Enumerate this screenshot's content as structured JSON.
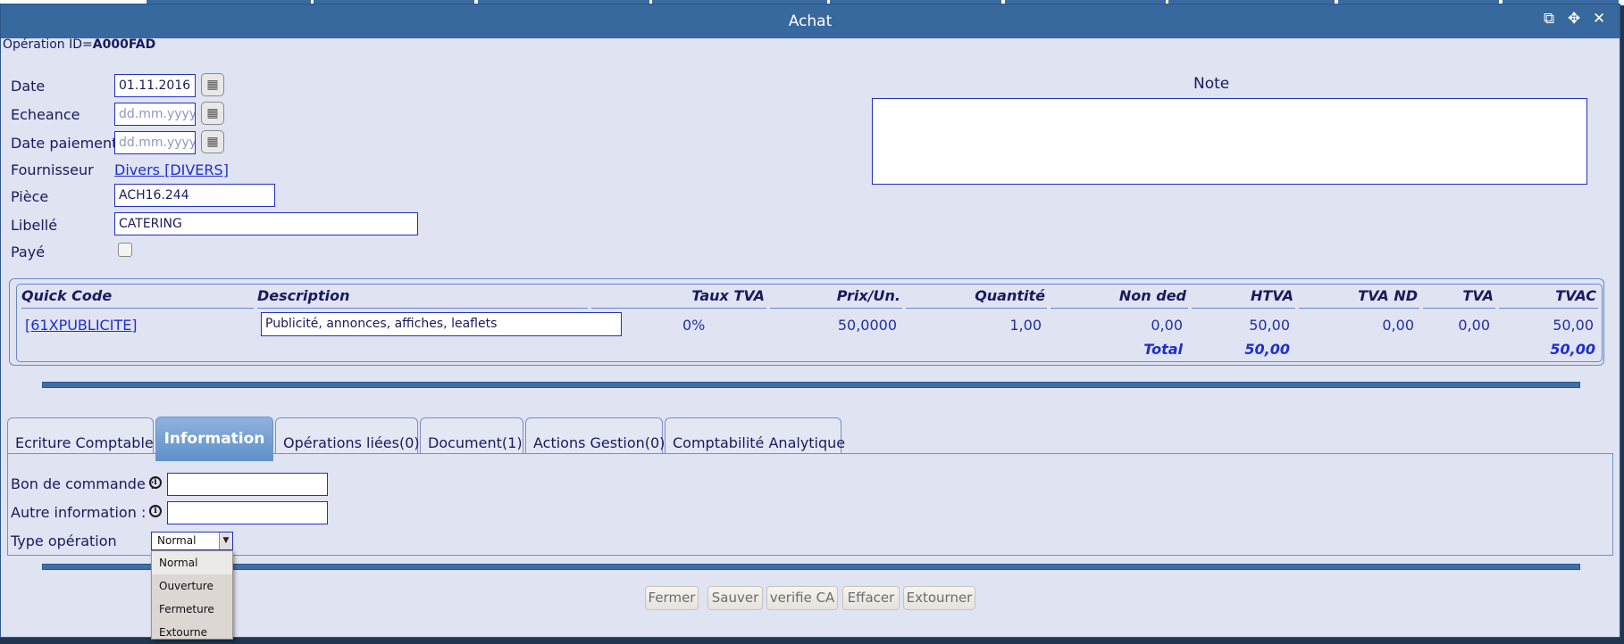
{
  "dialog": {
    "title": "Achat",
    "operation_id_label": "Opération ID=",
    "operation_id_value": "A000FAD"
  },
  "form": {
    "date_label": "Date",
    "date_value": "01.11.2016",
    "echeance_label": "Echeance",
    "echeance_placeholder": "dd.mm.yyyy",
    "date_paiement_label": "Date paiement",
    "date_paiement_placeholder": "dd.mm.yyyy",
    "fournisseur_label": "Fournisseur",
    "fournisseur_value": "Divers [DIVERS]",
    "piece_label": "Pièce",
    "piece_value": "ACH16.244",
    "libelle_label": "Libellé",
    "libelle_value": "CATERING",
    "paye_label": "Payé",
    "paye_checked": false
  },
  "note": {
    "label": "Note",
    "value": ""
  },
  "lines": {
    "headers": [
      "Quick Code",
      "Description",
      "Taux TVA",
      "Prix/Un.",
      "Quantité",
      "Non ded",
      "HTVA",
      "TVA ND",
      "TVA",
      "TVAC"
    ],
    "rows": [
      {
        "quick_code": "[61XPUBLICITE]",
        "description": "Publicité, annonces, affiches, leaflets",
        "taux_tva": "0%",
        "prix_un": "50,0000",
        "quantite": "1,00",
        "non_ded": "0,00",
        "htva": "50,00",
        "tva_nd": "0,00",
        "tva": "0,00",
        "tvac": "50,00"
      }
    ],
    "total_label": "Total",
    "total_htva": "50,00",
    "total_tvac": "50,00"
  },
  "tabs": [
    {
      "label": "Ecriture Comptable",
      "active": false
    },
    {
      "label": "Information",
      "active": true
    },
    {
      "label": "Opérations liées(0)",
      "active": false
    },
    {
      "label": "Document(1)",
      "active": false
    },
    {
      "label": "Actions Gestion(0)",
      "active": false
    },
    {
      "label": "Comptabilité Analytique",
      "active": false
    }
  ],
  "information": {
    "bon_commande_label": "Bon de commande :",
    "bon_commande_value": "",
    "autre_info_label": "Autre information :",
    "autre_info_value": "",
    "type_operation_label": "Type opération",
    "type_operation_selected": "Normal",
    "type_operation_options": [
      "Normal",
      "Ouverture",
      "Fermeture",
      "Extourne"
    ]
  },
  "buttons": {
    "fermer": "Fermer",
    "sauver": "Sauver",
    "verifie_ca": "verifie CA",
    "effacer": "Effacer",
    "extourner": "Extourner"
  },
  "icons": {
    "popout": "external-link-icon",
    "move": "move-icon",
    "close": "close-icon",
    "calendar": "calendar-icon",
    "info": "info-icon"
  }
}
